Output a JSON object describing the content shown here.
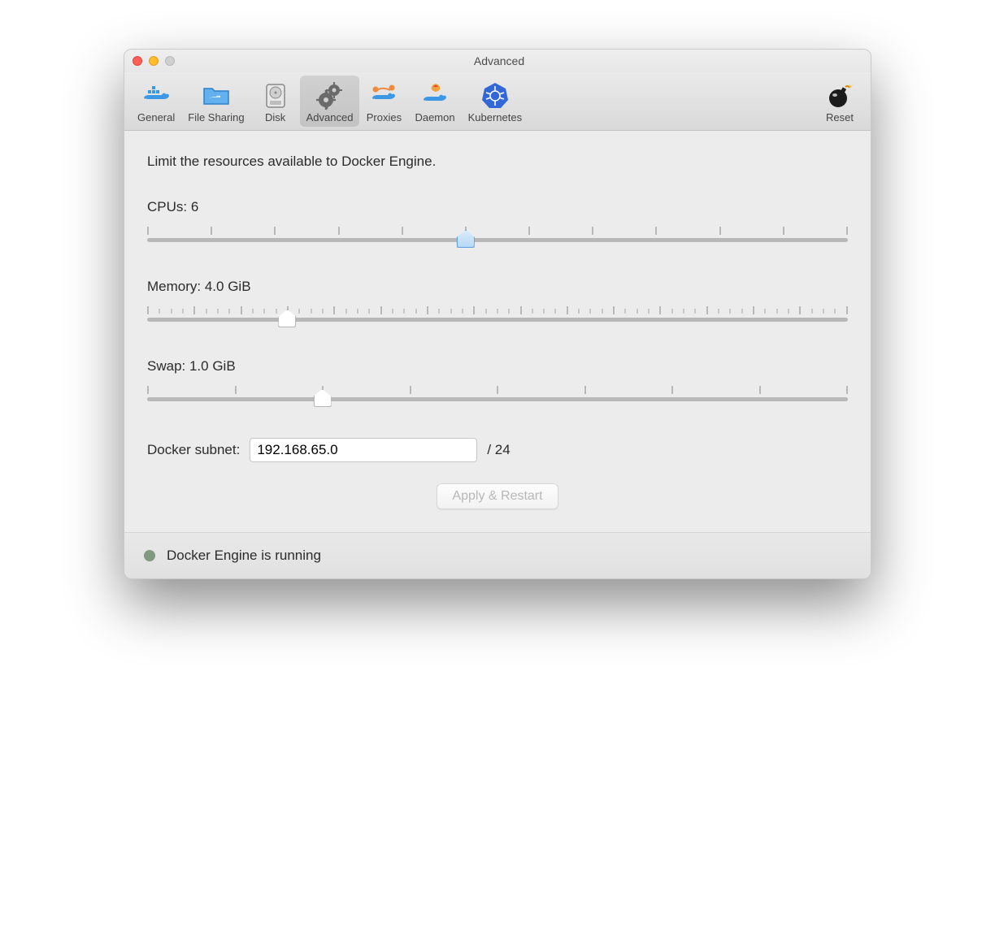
{
  "window": {
    "title": "Advanced"
  },
  "toolbar": {
    "items": [
      {
        "id": "general",
        "label": "General"
      },
      {
        "id": "filesharing",
        "label": "File Sharing"
      },
      {
        "id": "disk",
        "label": "Disk"
      },
      {
        "id": "advanced",
        "label": "Advanced"
      },
      {
        "id": "proxies",
        "label": "Proxies"
      },
      {
        "id": "daemon",
        "label": "Daemon"
      },
      {
        "id": "kubernetes",
        "label": "Kubernetes"
      }
    ],
    "reset_label": "Reset",
    "selected": "advanced"
  },
  "content": {
    "description": "Limit the resources available to Docker Engine.",
    "cpus": {
      "label": "CPUs: 6",
      "min": 1,
      "max": 12,
      "value": 6,
      "ticks": 12,
      "minor": false
    },
    "memory": {
      "label": "Memory: 4.0 GiB",
      "min": 1,
      "max": 16,
      "value": 4.0,
      "ticks": 16,
      "minor": true
    },
    "swap": {
      "label": "Swap: 1.0 GiB",
      "min": 0,
      "max": 4.0,
      "value": 1.0,
      "ticks": 9,
      "minor": false
    },
    "subnet": {
      "label": "Docker subnet:",
      "value": "192.168.65.0",
      "suffix": "/ 24"
    },
    "apply_label": "Apply & Restart"
  },
  "status": {
    "text": "Docker Engine is running",
    "color": "#7f9a7e"
  }
}
